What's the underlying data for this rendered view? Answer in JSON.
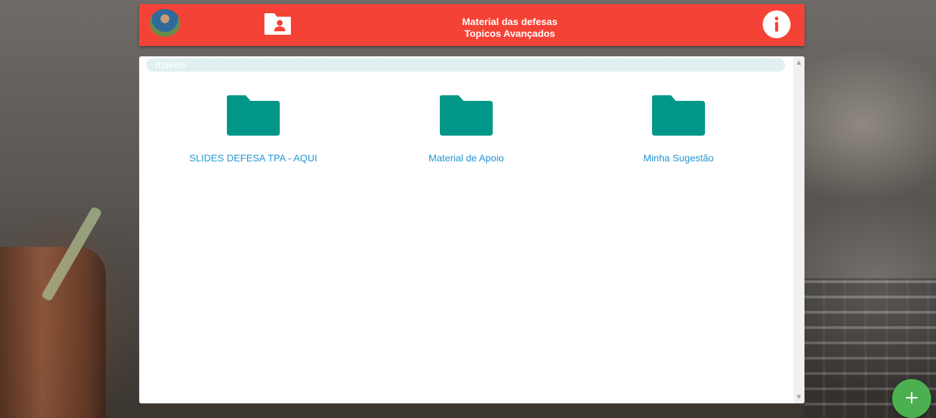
{
  "header": {
    "title_line1": "Material das defesas",
    "title_line2": "Topicos Avançados",
    "background_color": "#f44336",
    "avatar_icon": "user-avatar",
    "folder_user_icon": "folder-shared-icon",
    "info_icon": "info-icon"
  },
  "main": {
    "breadcrumb": "maven/",
    "folders": [
      {
        "label": "SLIDES DEFESA TPA - AQUI",
        "icon": "folder-icon"
      },
      {
        "label": "Material de Apoio",
        "icon": "folder-icon"
      },
      {
        "label": "Minha Sugestão",
        "icon": "folder-icon"
      }
    ],
    "folder_color": "#009688",
    "link_color": "#2196d3"
  },
  "fab": {
    "symbol": "+",
    "color": "#4caf50"
  }
}
